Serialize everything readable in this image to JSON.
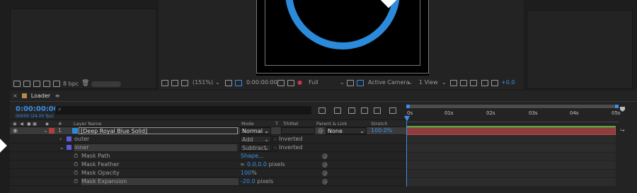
{
  "colors": {
    "accent": "#3a8ee6",
    "layer_label": "#b33c3c",
    "bar": "#a24545",
    "green": "#3fb23f"
  },
  "project_panel": {
    "bpc": "8 bpc"
  },
  "viewer": {
    "zoom": "(151%)",
    "timecode": "0:00:00:00",
    "resolution": "Full",
    "camera": "Active Camera",
    "view": "1 View",
    "exposure": "+0.0"
  },
  "comp": {
    "tab": "Loader",
    "timecode": "0:00:00:00",
    "fps": "00000 (24.00 fps)",
    "search_placeholder": ""
  },
  "headers": {
    "num": "#",
    "name": "Layer Name",
    "mode": "Mode",
    "t": "T",
    "trkmat": "TrkMat",
    "parent": "Parent & Link",
    "stretch": "Stretch"
  },
  "layer": {
    "num": "1",
    "name": "[Deep Royal Blue Solid]",
    "mode": "Normal",
    "parent": "None",
    "stretch": "100.0%"
  },
  "masks": [
    {
      "name": "outer",
      "mode": "Add",
      "inverted": "Inverted"
    },
    {
      "name": "inner",
      "mode": "Subtract",
      "inverted": "Inverted"
    }
  ],
  "props": [
    {
      "name": "Mask Path",
      "value": "Shape..."
    },
    {
      "name": "Mask Feather",
      "value": "0.0,0.0",
      "unit": " pixels"
    },
    {
      "name": "Mask Opacity",
      "value": "100",
      "unit": "%"
    },
    {
      "name": "Mask Expansion",
      "value": "-20.0",
      "unit": " pixels"
    }
  ],
  "ruler": [
    "0s",
    "01s",
    "02s",
    "03s",
    "04s",
    "05s"
  ]
}
